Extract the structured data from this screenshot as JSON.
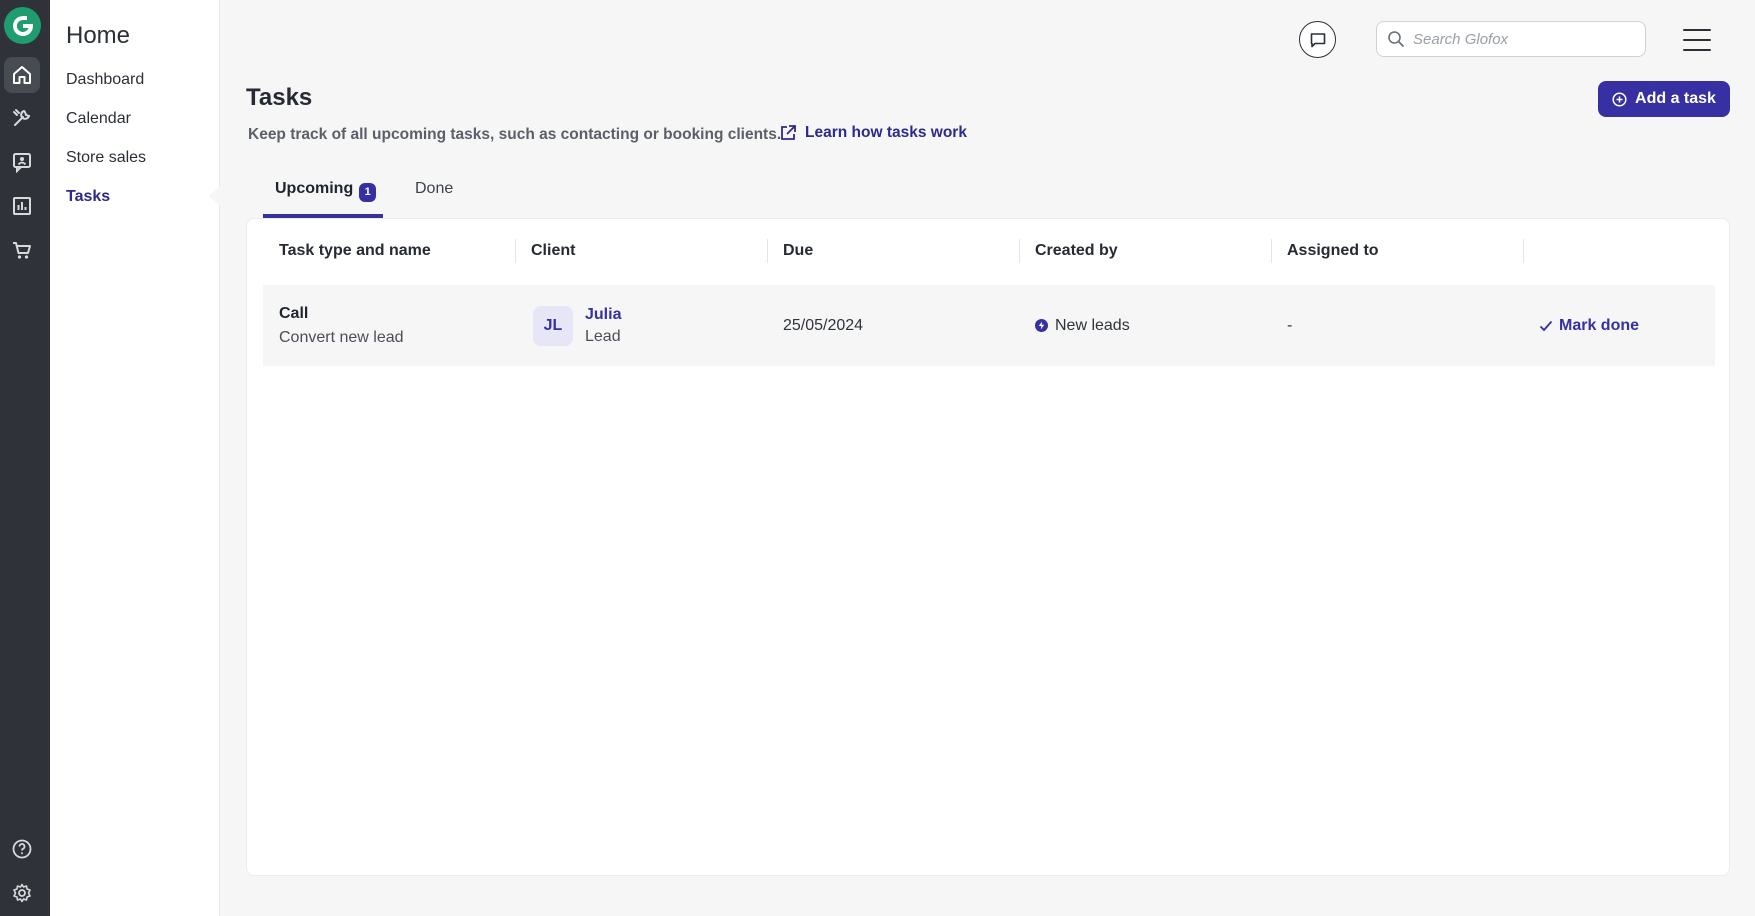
{
  "brand": {
    "accent": "#3730a3",
    "logo_color": "#1f9d6e",
    "rail_bg": "#2f3339"
  },
  "rail": {
    "icons": [
      "home-icon",
      "wrench-icon",
      "contact-card-icon",
      "bar-chart-icon",
      "cart-icon"
    ],
    "bottom_icons": [
      "help-icon",
      "gear-icon"
    ]
  },
  "subnav": {
    "title": "Home",
    "items": [
      {
        "label": "Dashboard"
      },
      {
        "label": "Calendar"
      },
      {
        "label": "Store sales"
      },
      {
        "label": "Tasks",
        "active": true
      }
    ]
  },
  "topbar": {
    "search_placeholder": "Search Glofox"
  },
  "header": {
    "title": "Tasks",
    "description": "Keep track of all upcoming tasks, such as contacting or booking clients.",
    "learn_link": "Learn how tasks work",
    "add_button": "Add a task"
  },
  "tabs": [
    {
      "label": "Upcoming",
      "count": "1",
      "active": true
    },
    {
      "label": "Done"
    }
  ],
  "table": {
    "columns": [
      "Task type and name",
      "Client",
      "Due",
      "Created by",
      "Assigned to",
      ""
    ],
    "rows": [
      {
        "task_type": "Call",
        "task_name": "Convert new lead",
        "client_initials": "JL",
        "client_name": "Julia",
        "client_type": "Lead",
        "due": "25/05/2024",
        "created_by": "New leads",
        "assigned_to": "-",
        "action": "Mark done"
      }
    ]
  }
}
